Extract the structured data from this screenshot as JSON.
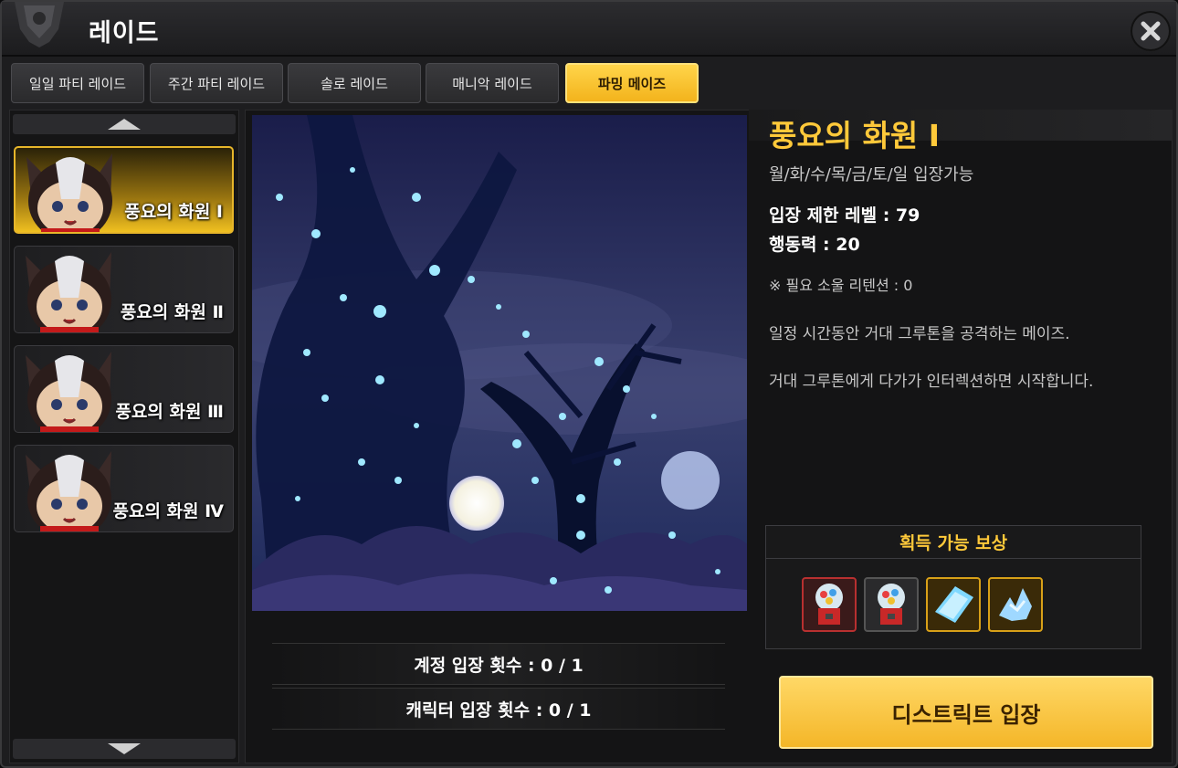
{
  "window": {
    "title": "레이드"
  },
  "tabs": [
    {
      "label": "일일 파티 레이드",
      "active": false
    },
    {
      "label": "주간 파티 레이드",
      "active": false
    },
    {
      "label": "솔로 레이드",
      "active": false
    },
    {
      "label": "매니악 레이드",
      "active": false
    },
    {
      "label": "파밍 메이즈",
      "active": true
    }
  ],
  "maze_list": [
    {
      "label": "풍요의 화원 Ⅰ",
      "selected": true
    },
    {
      "label": "풍요의 화원 Ⅱ",
      "selected": false
    },
    {
      "label": "풍요의 화원 Ⅲ",
      "selected": false
    },
    {
      "label": "풍요의 화원 Ⅳ",
      "selected": false
    }
  ],
  "detail": {
    "title": "풍요의 화원 Ⅰ",
    "days": "월/화/수/목/금/토/일 입장가능",
    "level": "입장 제한 레벨 : 79",
    "power": "행동력 : 20",
    "soul": "※ 필요 소울 리텐션 : 0",
    "desc1": "일정 시간동안 거대 그루톤을 공격하는 메이즈.",
    "desc2": "거대 그루톤에게 다가가 인터렉션하면 시작합니다."
  },
  "counts": {
    "account": "계정 입장 횟수 : 0 / 1",
    "character": "캐릭터 입장 횟수 : 0 / 1"
  },
  "rewards": {
    "title": "획득 가능 보상",
    "items": [
      "red-gacha-capsule-icon",
      "gacha-capsule-icon",
      "ice-crystal-icon",
      "crystal-dragon-icon"
    ]
  },
  "enter_button": "디스트릭트 입장",
  "colors": {
    "accent": "#f4b628",
    "title_gold": "#ffc93a",
    "panel": "#141415"
  }
}
